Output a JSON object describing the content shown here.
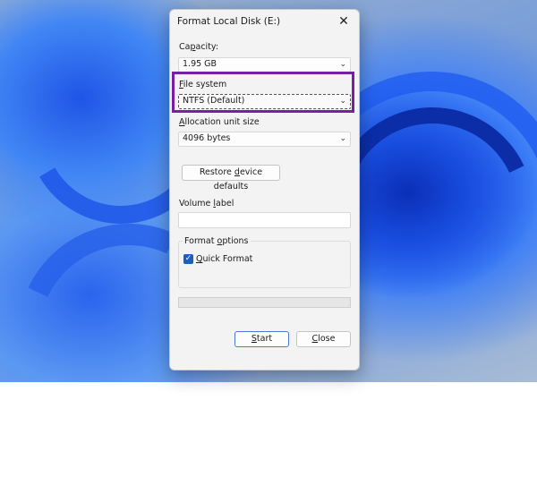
{
  "dialog": {
    "title": "Format Local Disk (E:)",
    "close_glyph": "✕"
  },
  "capacity": {
    "label_first": "Ca",
    "label_underline": "p",
    "label_rest": "acity:",
    "value": "1.95 GB"
  },
  "file_system": {
    "label_underline": "F",
    "label_rest": "ile system",
    "value": "NTFS (Default)"
  },
  "allocation": {
    "label_underline": "A",
    "label_rest": "llocation unit size",
    "value": "4096 bytes"
  },
  "restore_button": {
    "label_first": "Restore ",
    "label_underline": "d",
    "label_rest": "evice defaults"
  },
  "volume_label": {
    "label_first": "Volume ",
    "label_underline": "l",
    "label_rest": "abel",
    "value": ""
  },
  "format_options": {
    "title_first": "Format ",
    "title_underline": "o",
    "title_rest": "ptions",
    "quick_format": {
      "label_underline": "Q",
      "label_rest": "uick Format",
      "checked": true,
      "check_glyph": "✓"
    }
  },
  "progress": {
    "fraction": 0
  },
  "buttons": {
    "start_underline": "S",
    "start_rest": "tart",
    "close_underline": "C",
    "close_rest": "lose"
  },
  "icons": {
    "chevron": "⌄"
  },
  "colors": {
    "highlight": "#7b1fa2",
    "checkbox": "#1b5fbf"
  }
}
